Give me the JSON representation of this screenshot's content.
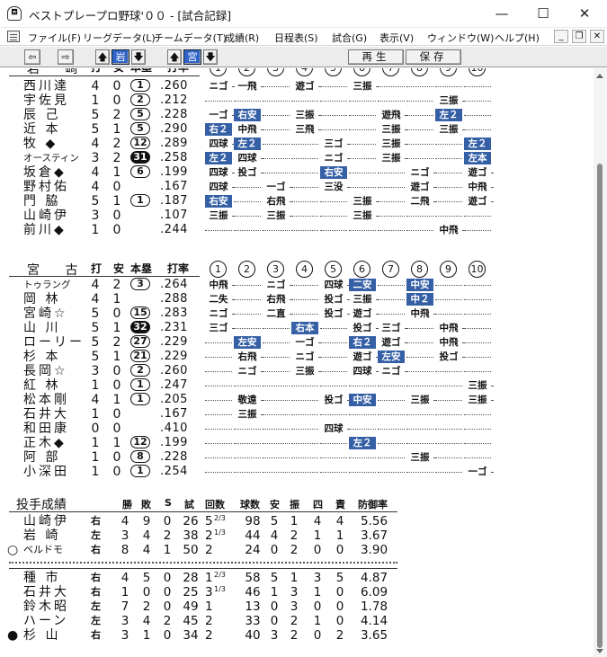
{
  "window": {
    "title": "ベストプレープロ野球'００ - [試合記録]",
    "minimize": "—",
    "maximize": "☐",
    "close": "✕"
  },
  "menu": [
    "ファイル(F)",
    "リーグデータ(L)",
    "チームデータ(T)",
    "成績(R)",
    "日程表(S)",
    "試合(G)",
    "表示(V)",
    "ウィンドウ(W)",
    "ヘルプ(H)"
  ],
  "mdi": {
    "minimize": "_",
    "restore": "❐",
    "close": "✕"
  },
  "toolbar": {
    "prev": "⇦",
    "next": "⇨",
    "up1": "🡅",
    "team1": "岩",
    "down1": "🡇",
    "up2": "🡅",
    "team2": "宮",
    "down2": "🡇",
    "play": "再生",
    "save": "保存"
  },
  "batting": [
    {
      "team": "岩",
      "header": {
        "team": "岩 崎",
        "ab": "打",
        "h": "安",
        "hr": "本塁",
        "avg": "打率",
        "innings": [
          "1",
          "2",
          "3",
          "4",
          "5",
          "6",
          "7",
          "8",
          "9",
          "10"
        ]
      },
      "rows": [
        {
          "name": "西川達",
          "ab": "4",
          "h": "0",
          "hr": "1",
          "avg": ".260",
          "s": [
            "ニゴ",
            "一飛",
            "…",
            "遊ゴ",
            "…",
            "三振",
            "…",
            "…",
            "…",
            "…"
          ]
        },
        {
          "name": "宇佐見",
          "ab": "1",
          "h": "0",
          "hr": "2",
          "avg": ".212",
          "s": [
            "…",
            "…",
            "…",
            "…",
            "…",
            "…",
            "…",
            "…",
            "三振",
            "…"
          ]
        },
        {
          "name": "辰 己",
          "ab": "5",
          "h": "2",
          "hr": "5",
          "avg": ".228",
          "s": [
            "一ゴ",
            "右安",
            "…",
            "三振",
            "…",
            "…",
            "遊飛",
            "…",
            "左２",
            "…"
          ]
        },
        {
          "name": "近 本",
          "ab": "5",
          "h": "1",
          "hr": "5",
          "avg": ".290",
          "s": [
            "右２",
            "中飛",
            "…",
            "三飛",
            "…",
            "…",
            "三振",
            "…",
            "三振",
            "…"
          ]
        },
        {
          "name": "牧 ◆",
          "ab": "4",
          "h": "2",
          "hr": "12",
          "avg": ".289",
          "s": [
            "四球",
            "左２",
            "…",
            "…",
            "三ゴ",
            "…",
            "三振",
            "…",
            "…",
            "左２"
          ]
        },
        {
          "name": "オースティン",
          "small": true,
          "ab": "3",
          "h": "2",
          "hr": "31",
          "hrBlack": true,
          "avg": ".258",
          "s": [
            "左２",
            "四球",
            "…",
            "…",
            "ニゴ",
            "…",
            "三振",
            "…",
            "…",
            "左本"
          ]
        },
        {
          "name": "坂倉◆",
          "ab": "4",
          "h": "1",
          "hr": "6",
          "avg": ".199",
          "s": [
            "四球",
            "投ゴ",
            "…",
            "…",
            "右安",
            "…",
            "…",
            "ニゴ",
            "…",
            "遊ゴ"
          ]
        },
        {
          "name": "野村佑",
          "ab": "4",
          "h": "0",
          "hr": "",
          "avg": ".167",
          "s": [
            "四球",
            "…",
            "一ゴ",
            "…",
            "三没",
            "…",
            "…",
            "遊ゴ",
            "…",
            "中飛"
          ]
        },
        {
          "name": "門 脇",
          "ab": "5",
          "h": "1",
          "hr": "1",
          "avg": ".187",
          "s": [
            "右安",
            "…",
            "右飛",
            "…",
            "…",
            "三振",
            "…",
            "二飛",
            "…",
            "遊ゴ"
          ]
        },
        {
          "name": "山崎伊",
          "ab": "3",
          "h": "0",
          "hr": "",
          "avg": ".107",
          "s": [
            "三振",
            "…",
            "三振",
            "…",
            "…",
            "三振",
            "…",
            "…",
            "…",
            "…"
          ]
        },
        {
          "name": "前川◆",
          "ab": "1",
          "h": "0",
          "hr": "",
          "avg": ".244",
          "s": [
            "…",
            "…",
            "…",
            "…",
            "…",
            "…",
            "…",
            "…",
            "中飛",
            "…"
          ]
        }
      ]
    },
    {
      "team": "宮",
      "header": {
        "team": "宮 古",
        "ab": "打",
        "h": "安",
        "hr": "本塁",
        "avg": "打率",
        "innings": [
          "1",
          "2",
          "3",
          "4",
          "5",
          "6",
          "7",
          "8",
          "9",
          "10"
        ]
      },
      "rows": [
        {
          "name": "トゥラング",
          "small": true,
          "ab": "4",
          "h": "2",
          "hr": "3",
          "avg": ".264",
          "s": [
            "中飛",
            "…",
            "ニゴ",
            "…",
            "四球",
            "二安",
            "…",
            "中安",
            "…",
            "…"
          ]
        },
        {
          "name": "岡 林",
          "ab": "4",
          "h": "1",
          "hr": "",
          "avg": ".288",
          "s": [
            "二失",
            "…",
            "右飛",
            "…",
            "投ゴ",
            "三振",
            "…",
            "中２",
            "…",
            "…"
          ]
        },
        {
          "name": "宮崎☆",
          "ab": "5",
          "h": "0",
          "hr": "15",
          "avg": ".283",
          "s": [
            "ニゴ",
            "…",
            "二直",
            "…",
            "投ゴ",
            "遊ゴ",
            "…",
            "中飛",
            "…",
            "…"
          ]
        },
        {
          "name": "山 川",
          "ab": "5",
          "h": "1",
          "hr": "32",
          "hrBlack": true,
          "avg": ".231",
          "s": [
            "三ゴ",
            "…",
            "…",
            "右本",
            "…",
            "投ゴ",
            "三ゴ",
            "…",
            "中飛",
            "…"
          ]
        },
        {
          "name": "ローリー",
          "ab": "5",
          "h": "2",
          "hr": "27",
          "avg": ".229",
          "s": [
            "…",
            "左安",
            "…",
            "一ゴ",
            "…",
            "右２",
            "遊ゴ",
            "…",
            "中飛",
            "…"
          ]
        },
        {
          "name": "杉 本",
          "ab": "5",
          "h": "1",
          "hr": "21",
          "avg": ".229",
          "s": [
            "…",
            "右飛",
            "…",
            "ニゴ",
            "…",
            "遊ゴ",
            "左安",
            "…",
            "投ゴ",
            "…"
          ]
        },
        {
          "name": "長岡☆",
          "ab": "3",
          "h": "0",
          "hr": "2",
          "avg": ".260",
          "s": [
            "…",
            "ニゴ",
            "…",
            "三振",
            "…",
            "四球",
            "ニゴ",
            "…",
            "…",
            "…"
          ]
        },
        {
          "name": "紅 林",
          "ab": "1",
          "h": "0",
          "hr": "1",
          "avg": ".247",
          "s": [
            "…",
            "…",
            "…",
            "…",
            "…",
            "…",
            "…",
            "…",
            "…",
            "三振"
          ]
        },
        {
          "name": "松本剛",
          "ab": "4",
          "h": "1",
          "hr": "1",
          "avg": ".205",
          "s": [
            "…",
            "敬遠",
            "…",
            "…",
            "投ゴ",
            "中安",
            "…",
            "三振",
            "…",
            "三振"
          ]
        },
        {
          "name": "石井大",
          "ab": "1",
          "h": "0",
          "hr": "",
          "avg": ".167",
          "s": [
            "…",
            "三振",
            "…",
            "…",
            "…",
            "…",
            "…",
            "…",
            "…",
            "…"
          ]
        },
        {
          "name": "和田康",
          "ab": "0",
          "h": "0",
          "hr": "",
          "avg": ".410",
          "s": [
            "…",
            "…",
            "…",
            "…",
            "四球",
            "…",
            "…",
            "…",
            "…",
            "…"
          ]
        },
        {
          "name": "正木◆",
          "ab": "1",
          "h": "1",
          "hr": "12",
          "avg": ".199",
          "s": [
            "…",
            "…",
            "…",
            "…",
            "…",
            "左２",
            "…",
            "…",
            "…",
            "…"
          ]
        },
        {
          "name": "阿 部",
          "ab": "1",
          "h": "0",
          "hr": "8",
          "avg": ".228",
          "s": [
            "…",
            "…",
            "…",
            "…",
            "…",
            "…",
            "…",
            "三振",
            "…",
            "…"
          ]
        },
        {
          "name": "小深田",
          "ab": "1",
          "h": "0",
          "hr": "1",
          "avg": ".254",
          "s": [
            "…",
            "…",
            "…",
            "…",
            "…",
            "…",
            "…",
            "…",
            "…",
            "一ゴ"
          ]
        }
      ]
    }
  ],
  "pitching": {
    "title": "投手成績",
    "header": {
      "w": "勝",
      "l": "敗",
      "s": "S",
      "g": "試",
      "ip": "回数",
      "pitches": "球数",
      "h": "安",
      "so": "振",
      "bb": "四",
      "er": "責",
      "era": "防御率"
    },
    "groups": [
      [
        {
          "mark": "",
          "name": "山崎伊",
          "hand": "右",
          "w": "4",
          "l": "9",
          "s": "0",
          "g": "26",
          "ipInt": "5",
          "ipFrac": "2/3",
          "pitches": "98",
          "h": "5",
          "so": "1",
          "bb": "4",
          "er": "4",
          "era": "5.56"
        },
        {
          "mark": "",
          "name": "岩 崎",
          "hand": "左",
          "w": "3",
          "l": "4",
          "s": "2",
          "g": "38",
          "ipInt": "2",
          "ipFrac": "1/3",
          "pitches": "44",
          "h": "4",
          "so": "2",
          "bb": "1",
          "er": "1",
          "era": "3.67"
        },
        {
          "mark": "○",
          "name": "ベルドモ",
          "small": true,
          "hand": "右",
          "w": "8",
          "l": "4",
          "s": "1",
          "g": "50",
          "ipInt": "2",
          "ipFrac": "",
          "pitches": "24",
          "h": "0",
          "so": "2",
          "bb": "0",
          "er": "0",
          "era": "3.90"
        }
      ],
      [
        {
          "mark": "",
          "name": "種 市",
          "hand": "右",
          "w": "4",
          "l": "5",
          "s": "0",
          "g": "28",
          "ipInt": "1",
          "ipFrac": "2/3",
          "pitches": "58",
          "h": "5",
          "so": "1",
          "bb": "3",
          "er": "5",
          "era": "4.87"
        },
        {
          "mark": "",
          "name": "石井大",
          "hand": "右",
          "w": "1",
          "l": "0",
          "s": "0",
          "g": "25",
          "ipInt": "3",
          "ipFrac": "1/3",
          "pitches": "46",
          "h": "1",
          "so": "3",
          "bb": "1",
          "er": "0",
          "era": "6.09"
        },
        {
          "mark": "",
          "name": "鈴木昭",
          "hand": "左",
          "w": "7",
          "l": "2",
          "s": "0",
          "g": "49",
          "ipInt": "1",
          "ipFrac": "",
          "pitches": "13",
          "h": "0",
          "so": "3",
          "bb": "0",
          "er": "0",
          "era": "1.78"
        },
        {
          "mark": "",
          "name": "ハーン",
          "hand": "左",
          "w": "3",
          "l": "4",
          "s": "2",
          "g": "45",
          "ipInt": "2",
          "ipFrac": "",
          "pitches": "33",
          "h": "0",
          "so": "2",
          "bb": "1",
          "er": "0",
          "era": "4.14"
        },
        {
          "mark": "●",
          "name": "杉 山",
          "hand": "右",
          "w": "3",
          "l": "1",
          "s": "0",
          "g": "34",
          "ipInt": "2",
          "ipFrac": "",
          "pitches": "40",
          "h": "3",
          "so": "2",
          "bb": "0",
          "er": "2",
          "era": "3.65"
        }
      ]
    ]
  }
}
